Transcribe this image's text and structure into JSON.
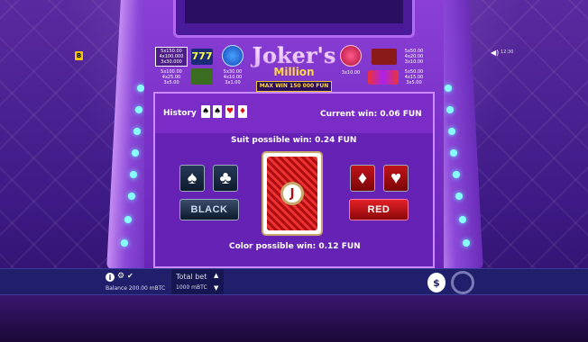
{
  "game": {
    "logo_line1": "Joker's",
    "logo_line2": "Million",
    "max_win": "MAX WIN 150 000 FUN",
    "badge_letter": "B",
    "time": "12:30"
  },
  "paytable_left": {
    "box1": [
      "5x150.00",
      "4x100.000",
      "3x30.000"
    ],
    "box2": [
      "5x100.00",
      "4x25.00",
      "3x5.00"
    ]
  },
  "paytable_center_left": [
    "5x30.00",
    "4x10.00",
    "3x1.00"
  ],
  "paytable_center_right": [
    "3x10.00"
  ],
  "paytable_right": [
    "5x50.00",
    "4x20.00",
    "3x10.00",
    "5x50.00",
    "4x15.00",
    "3x5.00"
  ],
  "gamble": {
    "history_label": "History",
    "history_cards": [
      {
        "suit": "♠",
        "color": "black"
      },
      {
        "suit": "♠",
        "color": "black"
      },
      {
        "suit": "♥",
        "color": "red"
      },
      {
        "suit": "♦",
        "color": "red"
      }
    ],
    "current_win": "Current win: 0.06 FUN",
    "suit_possible": "Suit possible win: 0.24 FUN",
    "color_possible": "Color possible win: 0.12 FUN",
    "suit_buttons": [
      {
        "suit": "♠",
        "color": "black"
      },
      {
        "suit": "♣",
        "color": "black"
      },
      {
        "suit": "♦",
        "color": "red"
      },
      {
        "suit": "♥",
        "color": "red"
      }
    ],
    "black_label": "BLACK",
    "red_label": "RED",
    "card_emblem": "J"
  },
  "bottom": {
    "balance": "Balance 200.00 mBTC",
    "total_bet_label": "Total bet",
    "total_bet_value": "1000 mBTC",
    "info_icon": "i"
  },
  "colors": {
    "accent_gold": "#ffd54a",
    "red_button": "#e32027",
    "panel": "#6621b5"
  }
}
